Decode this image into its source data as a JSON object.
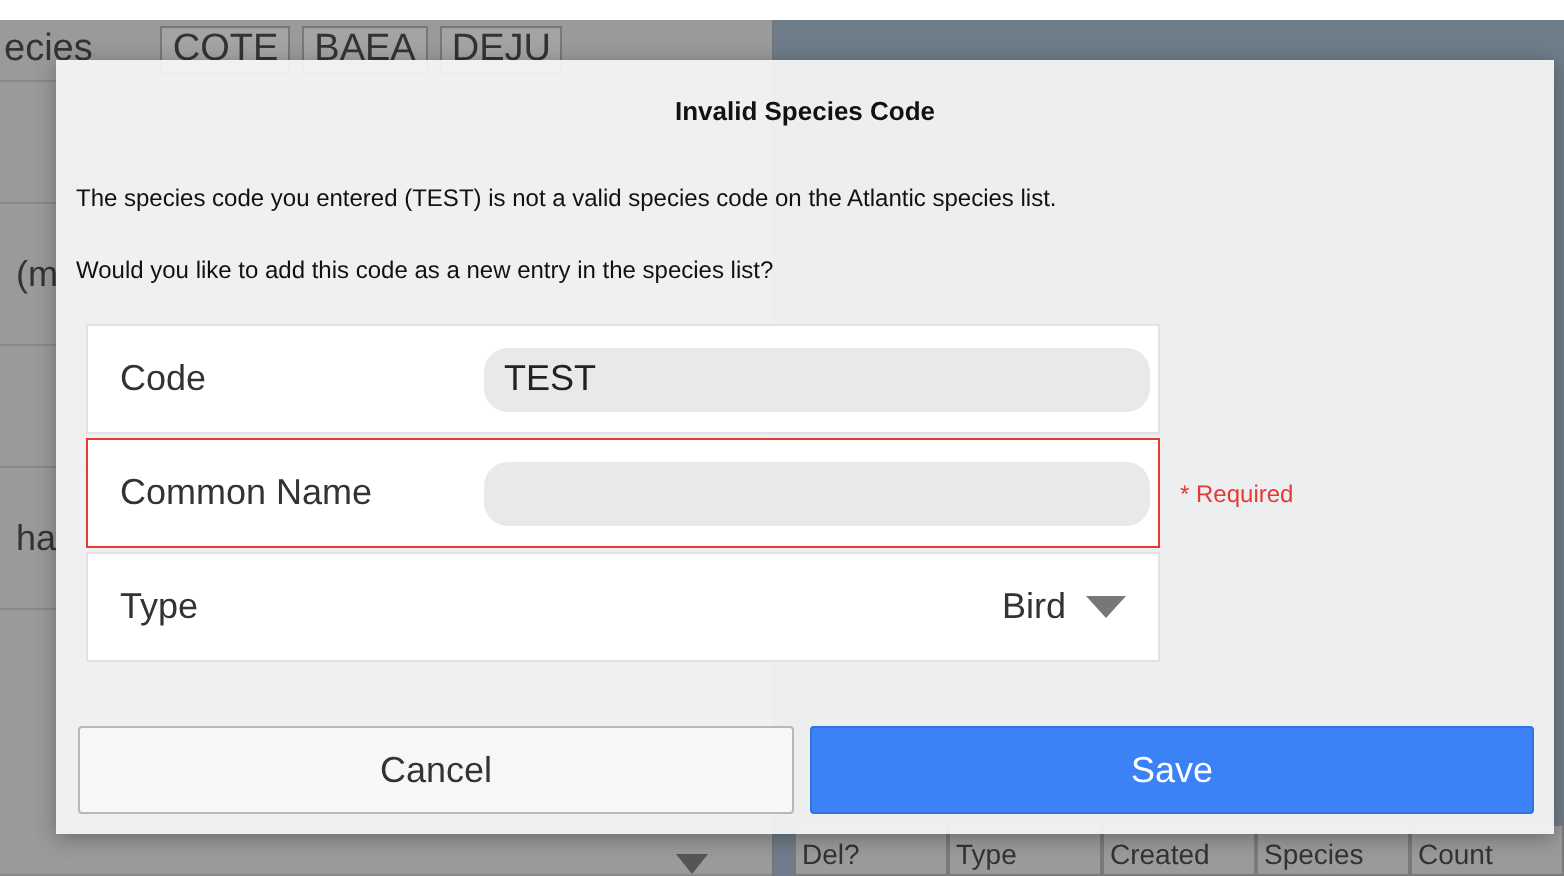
{
  "background": {
    "species_label": "ecies",
    "species_chips": [
      "COTE",
      "BAEA",
      "DEJU"
    ],
    "side_labels": [
      "(m",
      "ha"
    ],
    "table_columns": [
      "Del?",
      "Type",
      "Created",
      "Species",
      "Count"
    ]
  },
  "dialog": {
    "title": "Invalid Species Code",
    "messages": [
      "The species code you entered (TEST) is not a valid species code on the Atlantic species list.",
      "Would you like to add this code as a new entry in the species list?"
    ],
    "fields": [
      {
        "kind": "text",
        "label": "Code",
        "value": "TEST",
        "invalid": false
      },
      {
        "kind": "text",
        "label": "Common Name",
        "invalid": true,
        "note": "* Required"
      },
      {
        "kind": "select",
        "label": "Type",
        "value": "Bird",
        "invalid": false
      }
    ],
    "buttons": [
      {
        "label": "Cancel",
        "kind": "secondary"
      },
      {
        "label": "Save",
        "kind": "primary"
      }
    ]
  }
}
